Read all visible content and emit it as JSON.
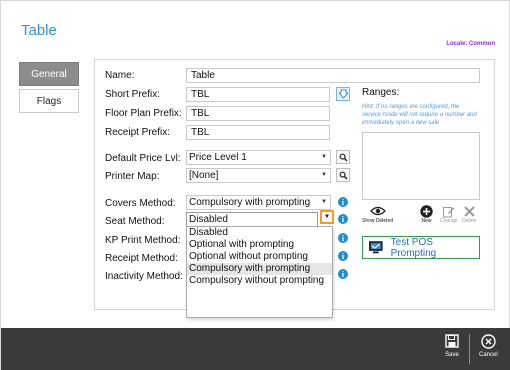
{
  "page": {
    "title": "Table",
    "locale": "Locale: Common"
  },
  "tabs": [
    {
      "label": "General",
      "active": true
    },
    {
      "label": "Flags",
      "active": false
    }
  ],
  "form": {
    "name": {
      "label": "Name:",
      "value": "Table"
    },
    "short_prefix": {
      "label": "Short Prefix:",
      "value": "TBL"
    },
    "floor_plan_prefix": {
      "label": "Floor Plan Prefix:",
      "value": "TBL"
    },
    "receipt_prefix": {
      "label": "Receipt Prefix:",
      "value": "TBL"
    },
    "default_price_lvl": {
      "label": "Default Price Lvl:",
      "value": "Price Level 1"
    },
    "printer_map": {
      "label": "Printer Map:",
      "value": "[None]"
    },
    "covers_method": {
      "label": "Covers Method:",
      "value": "Compulsory with prompting"
    },
    "seat_method": {
      "label": "Seat Method:",
      "value": "Disabled"
    },
    "kp_print_method": {
      "label": "KP Print Method:"
    },
    "receipt_method": {
      "label": "Receipt Method:"
    },
    "inactivity_method": {
      "label": "Inactivity Method:"
    }
  },
  "seat_dropdown": {
    "options": [
      "Disabled",
      "Optional with prompting",
      "Optional without prompting",
      "Compulsory with prompting",
      "Compulsory without prompting"
    ],
    "highlighted_index": 3
  },
  "ranges": {
    "title": "Ranges:",
    "hint": "Hint: If no ranges are configured, the service mode will not require a number and immediately open a new sale"
  },
  "range_tools": {
    "show_deleted": "Show Deleted",
    "new": "New",
    "change": "Change",
    "delete": "Delete"
  },
  "test_button": {
    "label": "Test POS Prompting"
  },
  "bottom_bar": {
    "save": "Save",
    "cancel": "Cancel"
  },
  "colors": {
    "accent": "#3b8ed8",
    "locale": "#8a2be2",
    "info": "#1f8ecf",
    "bar": "#3a3a3a",
    "focus": "#f0a020"
  }
}
